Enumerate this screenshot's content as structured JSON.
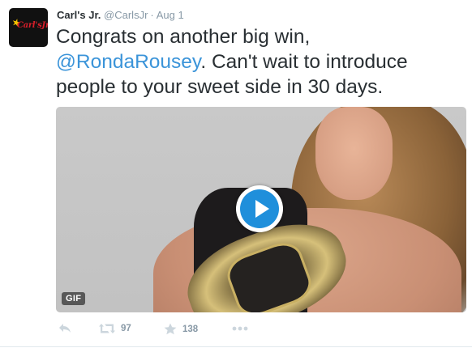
{
  "tweet": {
    "name": "Carl's Jr.",
    "handle": "@CarlsJr",
    "separator": "·",
    "time": "Aug 1",
    "text_line1": "Congrats on another big win,",
    "mention": "@RondaRousey",
    "text_rest_line2": ". Can't wait to introduce",
    "text_line3": "people to your sweet side in 30 days.",
    "avatar_logo_text": "Carl'sJr."
  },
  "media": {
    "badge": "GIF",
    "play_icon": "play-icon"
  },
  "actions": {
    "reply_icon": "reply-icon",
    "retweet_icon": "retweet-icon",
    "retweet_count": "97",
    "favorite_icon": "star-icon",
    "favorite_count": "138",
    "more_icon": "more-icon"
  },
  "colors": {
    "mention": "#3b94d9",
    "muted": "#8899a6",
    "play": "#1f8fdb"
  }
}
